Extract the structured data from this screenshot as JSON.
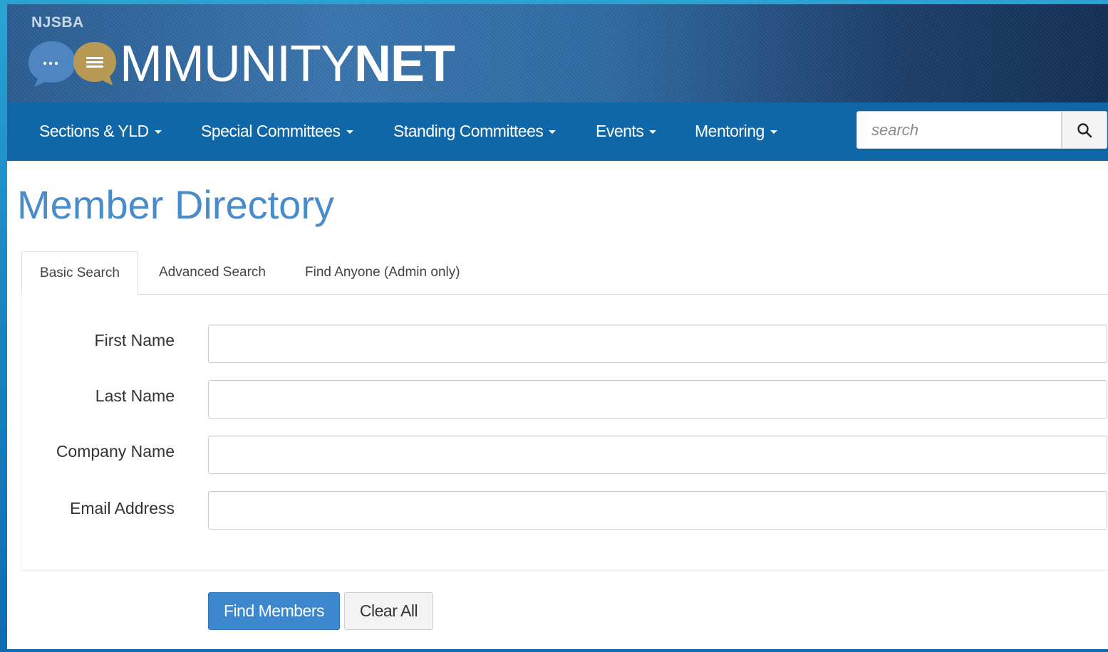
{
  "header": {
    "org": "NJSBA",
    "brand_prefix": "MMUNITY",
    "brand_suffix": "NET"
  },
  "nav": {
    "items": [
      {
        "label": "Sections & YLD"
      },
      {
        "label": "Special Committees"
      },
      {
        "label": "Standing Committees"
      },
      {
        "label": "Events"
      },
      {
        "label": "Mentoring"
      }
    ],
    "search_placeholder": "search"
  },
  "page": {
    "title": "Member Directory"
  },
  "tabs": [
    {
      "label": "Basic Search",
      "active": true
    },
    {
      "label": "Advanced Search",
      "active": false
    },
    {
      "label": "Find Anyone (Admin only)",
      "active": false
    }
  ],
  "form": {
    "fields": [
      {
        "label": "First Name",
        "value": ""
      },
      {
        "label": "Last Name",
        "value": ""
      },
      {
        "label": "Company Name",
        "value": ""
      },
      {
        "label": "Email Address",
        "value": ""
      }
    ]
  },
  "actions": {
    "find_label": "Find Members",
    "clear_label": "Clear All"
  },
  "colors": {
    "accent": "#3c87cd",
    "navbar": "#0f67a7",
    "title": "#4a8cc9",
    "logo_gold": "#b99a55",
    "logo_blue": "#4f86c2"
  }
}
